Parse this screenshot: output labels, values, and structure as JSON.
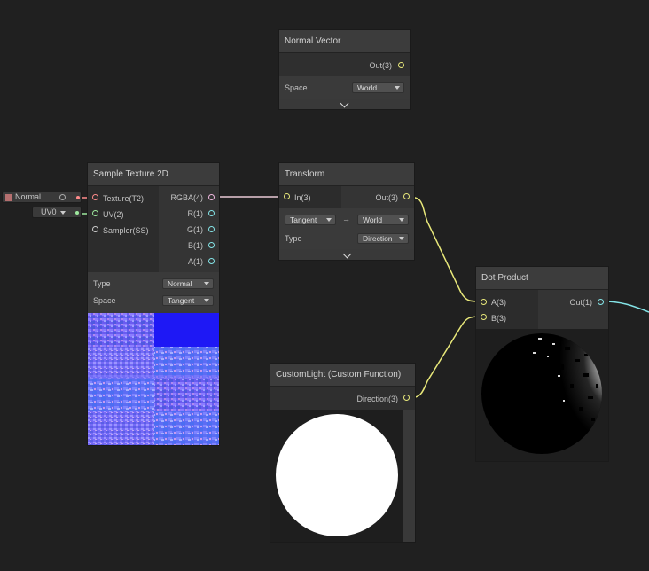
{
  "colors": {
    "background": "#202020",
    "vector3_port": "#e8e87a",
    "vector4_port": "#f0b8e0",
    "vector2_port": "#9ee89e",
    "float_port": "#84e4e7",
    "texture_port": "#ff8b8b",
    "sampler_port": "#cccccc"
  },
  "normal_vector_node": {
    "title": "Normal Vector",
    "out_label": "Out(3)",
    "space_label": "Space",
    "space_value": "World"
  },
  "texture_property": {
    "name": "Normal"
  },
  "uv_input": {
    "value": "UV0"
  },
  "sample_texture_node": {
    "title": "Sample Texture 2D",
    "inputs": [
      "Texture(T2)",
      "UV(2)",
      "Sampler(SS)"
    ],
    "outputs": [
      "RGBA(4)",
      "R(1)",
      "G(1)",
      "B(1)",
      "A(1)"
    ],
    "type_label": "Type",
    "type_value": "Normal",
    "space_label": "Space",
    "space_value": "Tangent"
  },
  "transform_node": {
    "title": "Transform",
    "in_label": "In(3)",
    "out_label": "Out(3)",
    "from_space": "Tangent",
    "arrow": "→",
    "to_space": "World",
    "type_label": "Type",
    "type_value": "Direction"
  },
  "custom_function_node": {
    "title": "CustomLight (Custom Function)",
    "out_label": "Direction(3)"
  },
  "dot_product_node": {
    "title": "Dot Product",
    "inputs": [
      "A(3)",
      "B(3)"
    ],
    "out_label": "Out(1)"
  }
}
